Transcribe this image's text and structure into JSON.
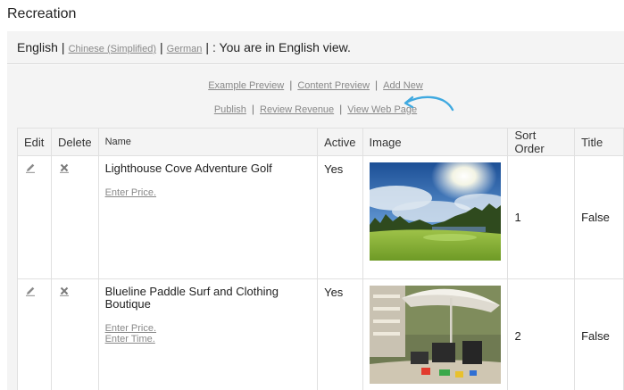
{
  "page": {
    "title": "Recreation"
  },
  "language_bar": {
    "current_language": "English",
    "languages": [
      "Chinese (Simplified)",
      "German"
    ],
    "status_text": ": You are in English view."
  },
  "toolbar": {
    "row1": [
      "Example Preview",
      "Content Preview",
      "Add New"
    ],
    "row2": [
      "Publish",
      "Review Revenue",
      "View Web Page"
    ],
    "separator": "|"
  },
  "colors": {
    "accent_arrow": "#3fa9e0",
    "link": "#888888",
    "panel_bg": "#f4f4f4"
  },
  "table": {
    "headers": [
      "Edit",
      "Delete",
      "Name",
      "Active",
      "Image",
      "Sort Order",
      "Title"
    ],
    "rows": [
      {
        "name": "Lighthouse Cove Adventure Golf",
        "links": [
          "Enter Price."
        ],
        "active": "Yes",
        "image": "golf-course-photo",
        "sort_order": "1",
        "title": "False"
      },
      {
        "name": "Blueline Paddle Surf and Clothing Boutique",
        "links": [
          "Enter Price.",
          "Enter Time."
        ],
        "active": "Yes",
        "image": "beach-patio-umbrella-photo",
        "sort_order": "2",
        "title": "False"
      }
    ]
  }
}
